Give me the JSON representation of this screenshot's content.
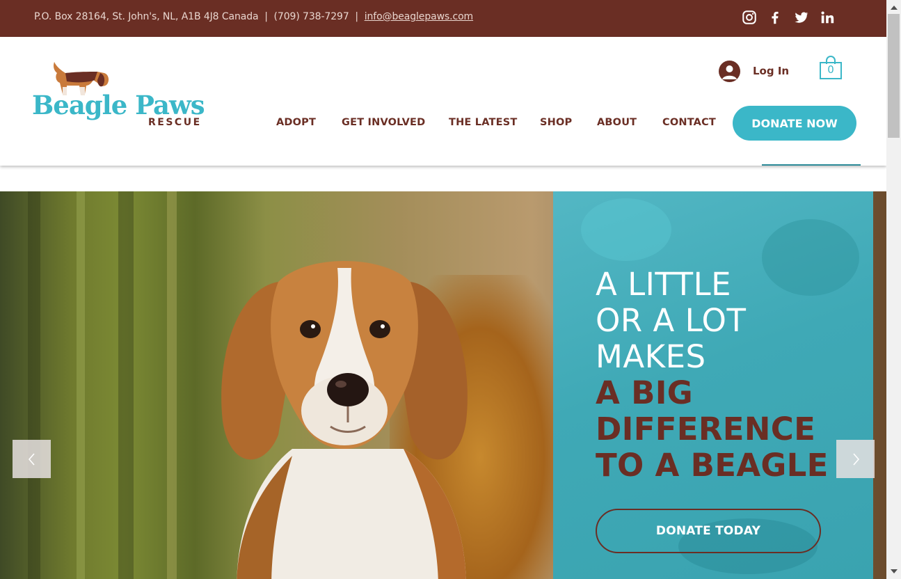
{
  "topbar": {
    "address": "P.O. Box 28164, St. John's, NL, A1B 4J8 Canada",
    "separator": "|",
    "phone": "(709) 738-7297",
    "email": "info@beaglepaws.com",
    "social": [
      "instagram-icon",
      "facebook-icon",
      "twitter-icon",
      "linkedin-icon"
    ]
  },
  "logo": {
    "word1": "Beagle Paws",
    "word2": "RESCUE"
  },
  "header": {
    "login_label": "Log In",
    "cart_count": "0"
  },
  "nav": {
    "items": [
      "ADOPT",
      "GET INVOLVED",
      "THE LATEST",
      "SHOP",
      "ABOUT",
      "CONTACT"
    ],
    "donate_label": "DONATE NOW"
  },
  "hero": {
    "line1": "A LITTLE",
    "line2": "OR A LOT",
    "line3": "MAKES",
    "line4": "A BIG",
    "line5": "DIFFERENCE",
    "line6": "TO A BEAGLE",
    "cta_label": "DONATE TODAY",
    "prev_icon": "chevron-left-icon",
    "next_icon": "chevron-right-icon"
  },
  "colors": {
    "brand_brown": "#6a2e24",
    "brand_teal": "#3bb7c8"
  }
}
